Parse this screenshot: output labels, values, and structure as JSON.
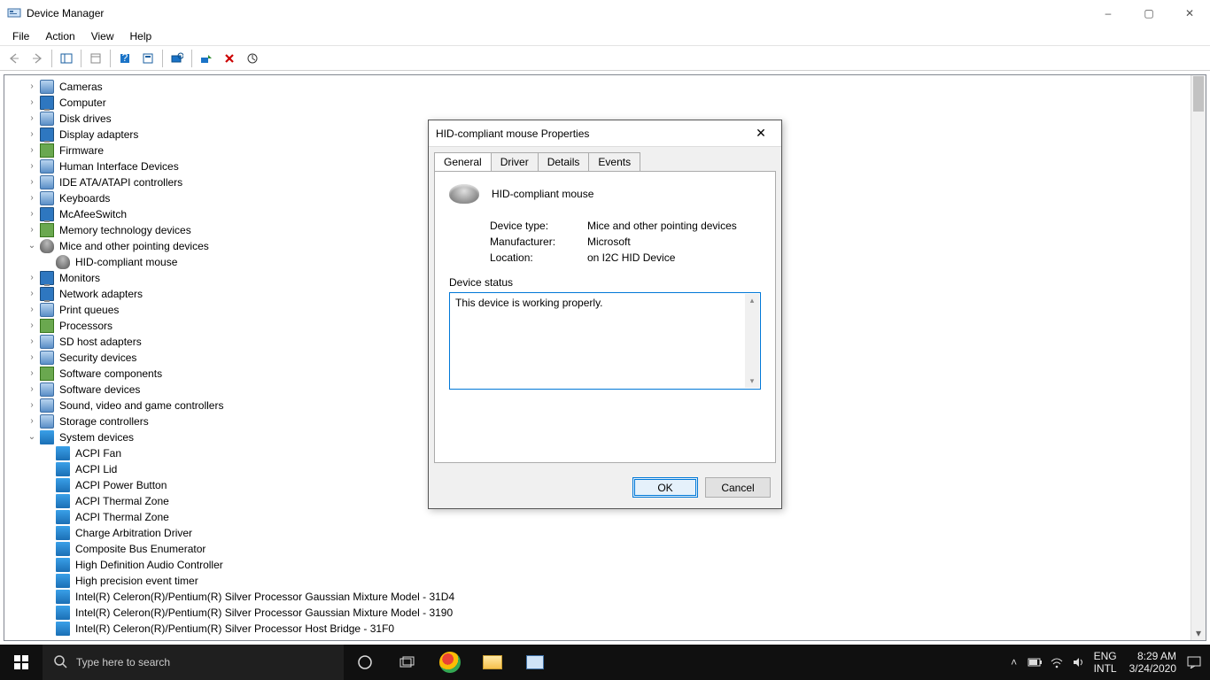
{
  "window": {
    "title": "Device Manager",
    "controls": {
      "min": "–",
      "max": "▢",
      "close": "✕"
    }
  },
  "menu": {
    "file": "File",
    "action": "Action",
    "view": "View",
    "help": "Help"
  },
  "tree": {
    "items": [
      {
        "label": "Cameras",
        "expanded": false,
        "icon": "generic"
      },
      {
        "label": "Computer",
        "expanded": false,
        "icon": "monitor"
      },
      {
        "label": "Disk drives",
        "expanded": false,
        "icon": "generic"
      },
      {
        "label": "Display adapters",
        "expanded": false,
        "icon": "monitor"
      },
      {
        "label": "Firmware",
        "expanded": false,
        "icon": "chip"
      },
      {
        "label": "Human Interface Devices",
        "expanded": false,
        "icon": "generic"
      },
      {
        "label": "IDE ATA/ATAPI controllers",
        "expanded": false,
        "icon": "generic"
      },
      {
        "label": "Keyboards",
        "expanded": false,
        "icon": "generic"
      },
      {
        "label": "McAfeeSwitch",
        "expanded": false,
        "icon": "monitor"
      },
      {
        "label": "Memory technology devices",
        "expanded": false,
        "icon": "chip"
      },
      {
        "label": "Mice and other pointing devices",
        "expanded": true,
        "icon": "mouse",
        "children": [
          {
            "label": "HID-compliant mouse",
            "icon": "mouse"
          }
        ]
      },
      {
        "label": "Monitors",
        "expanded": false,
        "icon": "monitor"
      },
      {
        "label": "Network adapters",
        "expanded": false,
        "icon": "monitor"
      },
      {
        "label": "Print queues",
        "expanded": false,
        "icon": "generic"
      },
      {
        "label": "Processors",
        "expanded": false,
        "icon": "chip"
      },
      {
        "label": "SD host adapters",
        "expanded": false,
        "icon": "generic"
      },
      {
        "label": "Security devices",
        "expanded": false,
        "icon": "generic"
      },
      {
        "label": "Software components",
        "expanded": false,
        "icon": "chip"
      },
      {
        "label": "Software devices",
        "expanded": false,
        "icon": "generic"
      },
      {
        "label": "Sound, video and game controllers",
        "expanded": false,
        "icon": "generic"
      },
      {
        "label": "Storage controllers",
        "expanded": false,
        "icon": "generic"
      },
      {
        "label": "System devices",
        "expanded": true,
        "icon": "folder",
        "children": [
          {
            "label": "ACPI Fan",
            "icon": "folder"
          },
          {
            "label": "ACPI Lid",
            "icon": "folder"
          },
          {
            "label": "ACPI Power Button",
            "icon": "folder"
          },
          {
            "label": "ACPI Thermal Zone",
            "icon": "folder"
          },
          {
            "label": "ACPI Thermal Zone",
            "icon": "folder"
          },
          {
            "label": "Charge Arbitration Driver",
            "icon": "folder"
          },
          {
            "label": "Composite Bus Enumerator",
            "icon": "folder"
          },
          {
            "label": "High Definition Audio Controller",
            "icon": "folder"
          },
          {
            "label": "High precision event timer",
            "icon": "folder"
          },
          {
            "label": "Intel(R) Celeron(R)/Pentium(R) Silver Processor Gaussian Mixture Model - 31D4",
            "icon": "folder"
          },
          {
            "label": "Intel(R) Celeron(R)/Pentium(R) Silver Processor Gaussian Mixture Model - 3190",
            "icon": "folder"
          },
          {
            "label": "Intel(R) Celeron(R)/Pentium(R) Silver Processor Host Bridge - 31F0",
            "icon": "folder"
          }
        ]
      }
    ]
  },
  "dialog": {
    "title": "HID-compliant mouse Properties",
    "tabs": {
      "general": "General",
      "driver": "Driver",
      "details": "Details",
      "events": "Events"
    },
    "deviceName": "HID-compliant mouse",
    "labels": {
      "deviceType": "Device type:",
      "manufacturer": "Manufacturer:",
      "location": "Location:",
      "status": "Device status"
    },
    "values": {
      "deviceType": "Mice and other pointing devices",
      "manufacturer": "Microsoft",
      "location": "on I2C HID Device"
    },
    "statusText": "This device is working properly.",
    "buttons": {
      "ok": "OK",
      "cancel": "Cancel"
    }
  },
  "taskbar": {
    "searchPlaceholder": "Type here to search",
    "lang1": "ENG",
    "lang2": "INTL",
    "time": "8:29 AM",
    "date": "3/24/2020"
  }
}
